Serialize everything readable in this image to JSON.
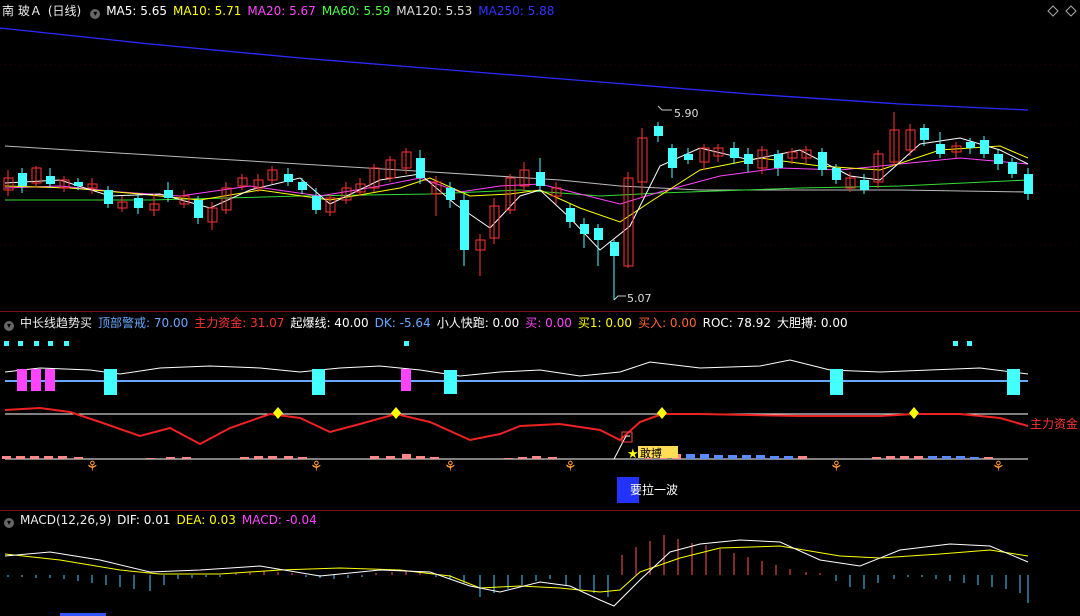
{
  "main": {
    "title": "南 玻Ａ",
    "period": "(日线)",
    "ma": [
      {
        "label": "MA5: 5.65",
        "color": "#ffffff"
      },
      {
        "label": "MA10: 5.71",
        "color": "#ffff00"
      },
      {
        "label": "MA20: 5.67",
        "color": "#ff44ff"
      },
      {
        "label": "MA60: 5.59",
        "color": "#44ff44"
      },
      {
        "label": "MA120: 5.53",
        "color": "#dddddd"
      },
      {
        "label": "MA250: 5.88",
        "color": "#3333ff"
      }
    ],
    "high_label": "5.90",
    "low_label": "5.07"
  },
  "ind": {
    "title": "中长线趋势买",
    "items": [
      {
        "label": "顶部警戒: 70.00",
        "color": "#66aaff"
      },
      {
        "label": "主力资金: 31.07",
        "color": "#ff3333"
      },
      {
        "label": "起爆线: 40.00",
        "color": "#ffffff"
      },
      {
        "label": "DK: -5.64",
        "color": "#66aaff"
      },
      {
        "label": "小人快跑: 0.00",
        "color": "#ffffff"
      },
      {
        "label": "买: 0.00",
        "color": "#ff44ff"
      },
      {
        "label": "买1: 0.00",
        "color": "#ffff00"
      },
      {
        "label": "买入: 0.00",
        "color": "#ff6633"
      },
      {
        "label": "ROC: 78.92",
        "color": "#ffffff"
      },
      {
        "label": "大胆搏: 0.00",
        "color": "#ffffff"
      }
    ],
    "line_label": "主力资金",
    "signal1": "敢搏",
    "signal2": "要拉一波"
  },
  "macd": {
    "title": "MACD(12,26,9)",
    "items": [
      {
        "label": "DIF: 0.01",
        "color": "#ffffff"
      },
      {
        "label": "DEA: 0.03",
        "color": "#ffff00"
      },
      {
        "label": "MACD: -0.04",
        "color": "#ff44ff"
      }
    ]
  },
  "chart_data": {
    "type": "candlestick",
    "series": [
      {
        "name": "MA5",
        "value": 5.65
      },
      {
        "name": "MA10",
        "value": 5.71
      },
      {
        "name": "MA20",
        "value": 5.67
      },
      {
        "name": "MA60",
        "value": 5.59
      },
      {
        "name": "MA120",
        "value": 5.53
      },
      {
        "name": "MA250",
        "value": 5.88
      }
    ],
    "annotations": [
      {
        "text": "5.90",
        "kind": "high"
      },
      {
        "text": "5.07",
        "kind": "low"
      }
    ]
  }
}
